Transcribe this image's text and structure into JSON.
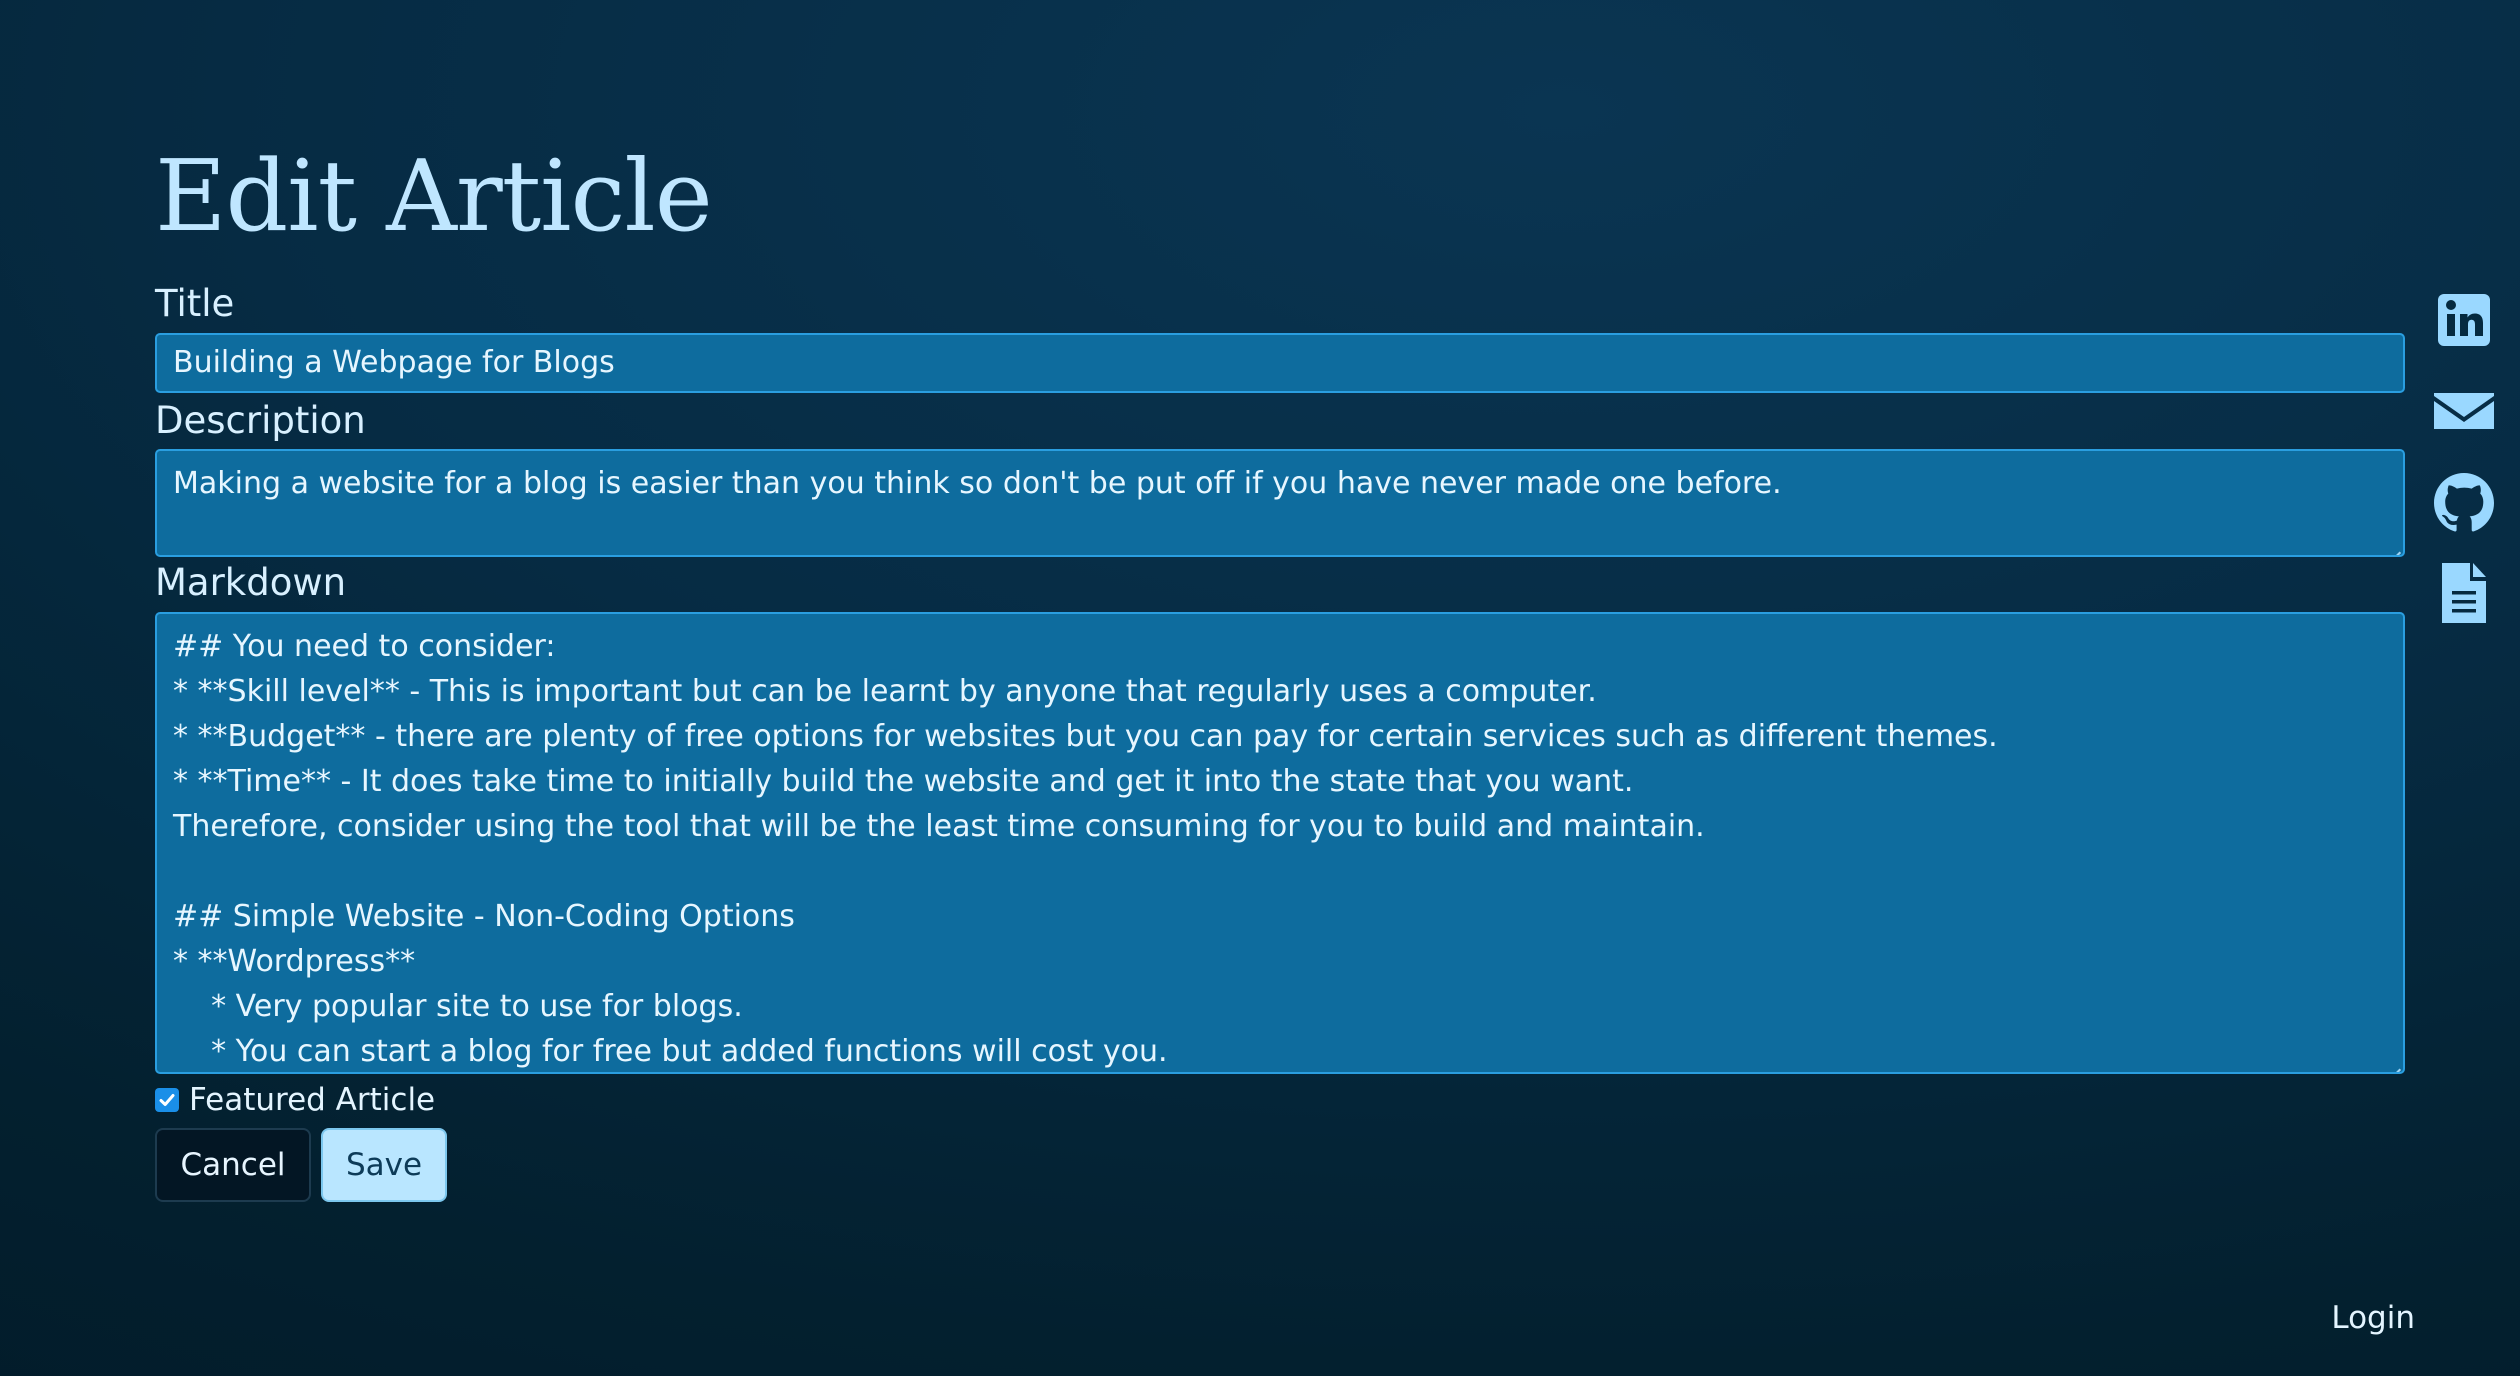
{
  "page": {
    "heading": "Edit Article"
  },
  "form": {
    "title_label": "Title",
    "title_value": "Building a Webpage for Blogs",
    "description_label": "Description",
    "description_value": "Making a website for a blog is easier than you think so don't be put off if you have never made one before.",
    "markdown_label": "Markdown",
    "markdown_lines": [
      "## You need to consider:",
      "* **Skill level** - This is important but can be learnt by anyone that regularly uses a computer.",
      "* **Budget** - there are plenty of free options for websites but you can pay for certain services such as different themes.",
      "* **Time** - It does take time to initially build the website and get it into the state that you want.",
      "Therefore, consider using the tool that will be the least time consuming for you to build and maintain.",
      "",
      "## Simple Website - Non-Coding Options",
      "* **Wordpress**",
      "    * Very popular site to use for blogs.",
      "    * You can start a blog for free but added functions will cost you."
    ],
    "featured_label": "Featured Article",
    "featured_checked": true,
    "cancel_label": "Cancel",
    "save_label": "Save"
  },
  "social_icons": [
    "linkedin-icon",
    "email-icon",
    "github-icon",
    "document-icon"
  ],
  "footer": {
    "login_label": "Login"
  },
  "colors": {
    "background": "#042538",
    "field_bg": "#0e6c9e",
    "field_border": "#2a9ee0",
    "accent_light": "#b9e6ff",
    "icon": "#9ad8ff"
  }
}
